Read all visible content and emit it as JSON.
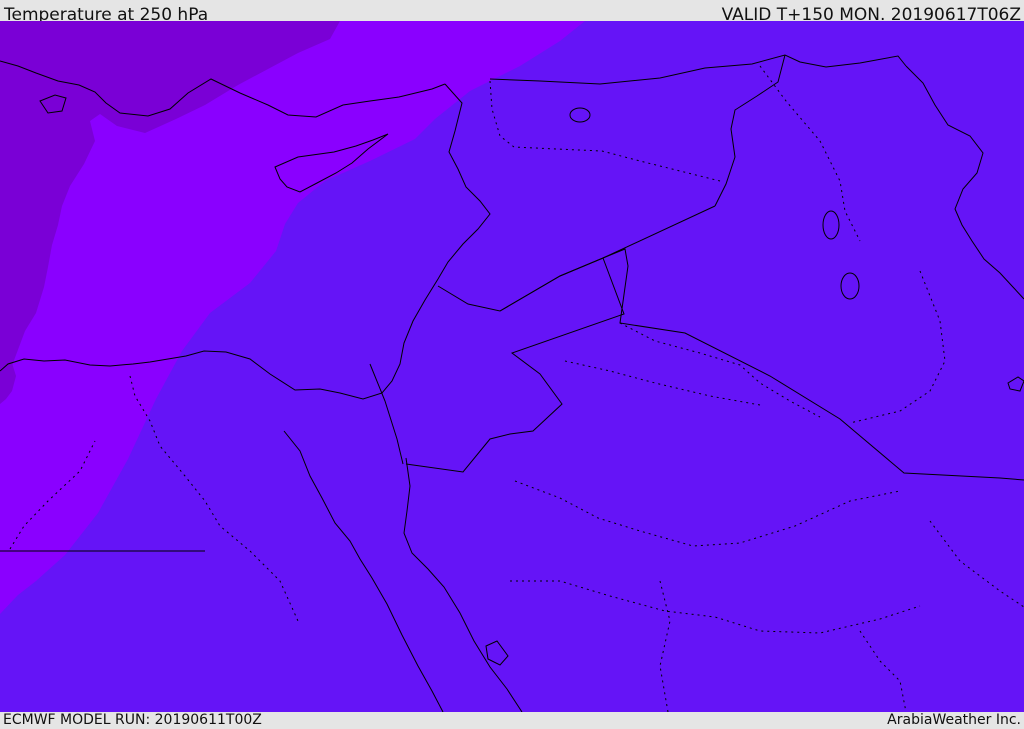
{
  "header": {
    "title": "Temperature at 250 hPa",
    "valid": "VALID T+150 MON. 20190617T06Z"
  },
  "footer": {
    "model_run": "ECMWF MODEL RUN: 20190611T00Z",
    "credit": "ArabiaWeather Inc."
  },
  "map": {
    "colors": {
      "dark_purple": "#7a00d6",
      "purple": "#8a00ff",
      "blue_violet": "#6514f7",
      "border": "#000000"
    }
  }
}
